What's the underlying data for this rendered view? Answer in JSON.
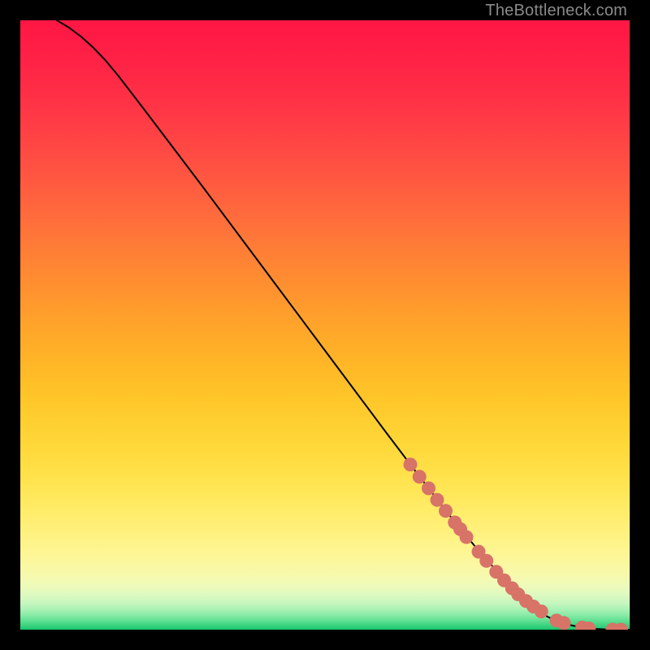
{
  "watermark": "TheBottleneck.com",
  "chart_data": {
    "type": "line",
    "title": "",
    "xlabel": "",
    "ylabel": "",
    "xlim": [
      0,
      100
    ],
    "ylim": [
      0,
      100
    ],
    "grid": false,
    "series": [
      {
        "name": "curve",
        "x": [
          6,
          8,
          10,
          12,
          14,
          16,
          20,
          30,
          40,
          50,
          60,
          65,
          70,
          75,
          80,
          84,
          86,
          88,
          90,
          92,
          94,
          96,
          98,
          100
        ],
        "y": [
          100,
          98.8,
          97.3,
          95.5,
          93.4,
          91.0,
          85.8,
          72.6,
          59.2,
          45.8,
          32.4,
          25.8,
          19.3,
          13.2,
          7.6,
          3.8,
          2.4,
          1.4,
          0.8,
          0.4,
          0.15,
          0.05,
          0.0,
          0.0
        ]
      }
    ],
    "markers": {
      "name": "highlight-dots",
      "x": [
        64,
        65.5,
        67,
        68.4,
        69.8,
        71.3,
        72.2,
        73.2,
        75.2,
        76.5,
        78.1,
        79.4,
        80.7,
        81.7,
        83.0,
        84.2,
        85.5,
        88.0,
        89.2,
        92.2,
        93.3,
        97.2,
        98.6
      ],
      "y": [
        27.1,
        25.1,
        23.2,
        21.3,
        19.5,
        17.6,
        16.5,
        15.2,
        12.8,
        11.3,
        9.5,
        8.1,
        6.8,
        5.8,
        4.7,
        3.8,
        3.0,
        1.5,
        1.1,
        0.35,
        0.2,
        0.02,
        0.0
      ]
    },
    "gradient_stops": [
      {
        "pos": 0.0,
        "color": "#ff1744"
      },
      {
        "pos": 0.035,
        "color": "#ff1c45"
      },
      {
        "pos": 0.07,
        "color": "#ff2346"
      },
      {
        "pos": 0.105,
        "color": "#ff2b46"
      },
      {
        "pos": 0.14,
        "color": "#ff3446"
      },
      {
        "pos": 0.175,
        "color": "#ff3e45"
      },
      {
        "pos": 0.21,
        "color": "#ff4844"
      },
      {
        "pos": 0.245,
        "color": "#ff5342"
      },
      {
        "pos": 0.28,
        "color": "#ff5e3f"
      },
      {
        "pos": 0.315,
        "color": "#ff693c"
      },
      {
        "pos": 0.35,
        "color": "#ff7539"
      },
      {
        "pos": 0.385,
        "color": "#ff8035"
      },
      {
        "pos": 0.42,
        "color": "#ff8b31"
      },
      {
        "pos": 0.455,
        "color": "#ff962e"
      },
      {
        "pos": 0.49,
        "color": "#ffa12b"
      },
      {
        "pos": 0.525,
        "color": "#ffab28"
      },
      {
        "pos": 0.56,
        "color": "#ffb527"
      },
      {
        "pos": 0.595,
        "color": "#ffbf28"
      },
      {
        "pos": 0.63,
        "color": "#ffc82b"
      },
      {
        "pos": 0.665,
        "color": "#ffd031"
      },
      {
        "pos": 0.7,
        "color": "#ffd83a"
      },
      {
        "pos": 0.735,
        "color": "#ffdf46"
      },
      {
        "pos": 0.77,
        "color": "#ffe656"
      },
      {
        "pos": 0.805,
        "color": "#ffec69"
      },
      {
        "pos": 0.84,
        "color": "#fff17e"
      },
      {
        "pos": 0.875,
        "color": "#fef695"
      },
      {
        "pos": 0.91,
        "color": "#f7f9ac"
      },
      {
        "pos": 0.93,
        "color": "#ecfabb"
      },
      {
        "pos": 0.945,
        "color": "#daf9c0"
      },
      {
        "pos": 0.958,
        "color": "#c2f6bd"
      },
      {
        "pos": 0.968,
        "color": "#a6f1b3"
      },
      {
        "pos": 0.976,
        "color": "#88eba6"
      },
      {
        "pos": 0.983,
        "color": "#6ae397"
      },
      {
        "pos": 0.989,
        "color": "#4eda89"
      },
      {
        "pos": 0.994,
        "color": "#36d17c"
      },
      {
        "pos": 0.998,
        "color": "#23c971"
      },
      {
        "pos": 1.0,
        "color": "#17c36a"
      }
    ],
    "marker_style": {
      "r": 8.5,
      "fill": "#d87368"
    },
    "line_style": {
      "stroke": "#000000",
      "width": 2
    }
  }
}
